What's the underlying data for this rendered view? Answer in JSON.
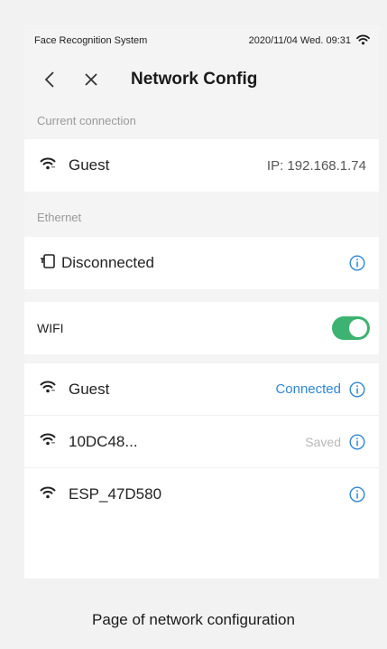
{
  "status_bar": {
    "app_name": "Face Recognition System",
    "datetime": "2020/11/04  Wed.  09:31"
  },
  "nav": {
    "title": "Network Config"
  },
  "current_connection": {
    "section_label": "Current connection",
    "ssid": "Guest",
    "ip_text": "IP:  192.168.1.74"
  },
  "ethernet": {
    "section_label": "Ethernet",
    "status": "Disconnected"
  },
  "wifi": {
    "label": "WIFI",
    "enabled": true,
    "networks": [
      {
        "ssid": "Guest",
        "status": "Connected"
      },
      {
        "ssid": "10DC48...",
        "status": "Saved"
      },
      {
        "ssid": "ESP_47D580",
        "status": ""
      }
    ]
  },
  "colors": {
    "accent": "#2f86d6",
    "toggle_on": "#3cb371",
    "section_text": "#9a9a9a"
  },
  "caption": "Page of network configuration"
}
